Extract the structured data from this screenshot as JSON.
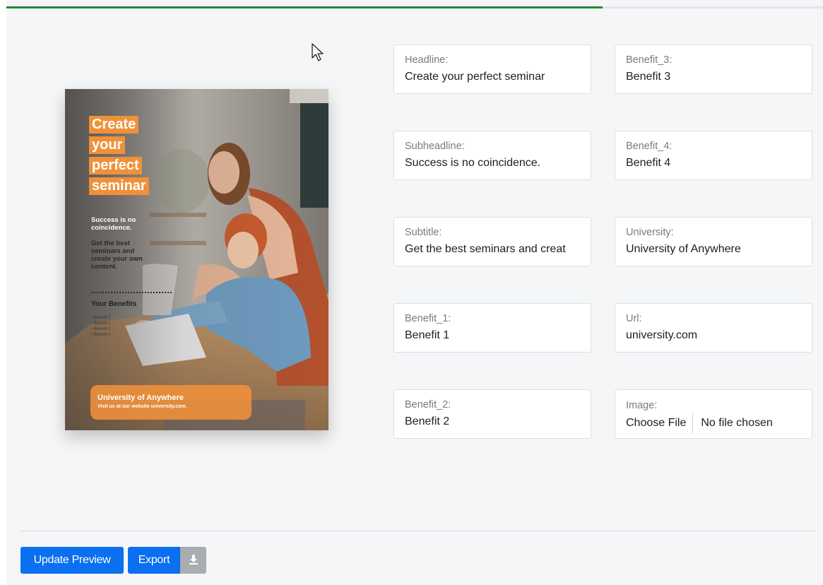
{
  "progress": {
    "fraction": 0.73,
    "color": "#1f8a3a"
  },
  "poster": {
    "headline_lines": [
      "Create",
      "your",
      "perfect",
      "seminar"
    ],
    "subheadline_lines": [
      "Success is no",
      "coincidence."
    ],
    "subtitle_lines": [
      "Get the best",
      "seminars and",
      "create your own",
      "content."
    ],
    "benefits_title": "Your Benefits",
    "benefits": [
      "• Benefit 1",
      "• Benefit 2",
      "• Benefit 3",
      "• Benefit 4"
    ],
    "university": "University of Anywhere",
    "visit_text": "Visit us at our website university.com.",
    "accent": "#f0913a"
  },
  "form": {
    "headline": {
      "label": "Headline:",
      "value": "Create your perfect seminar"
    },
    "subheadline": {
      "label": "Subheadline:",
      "value": "Success is no coincidence."
    },
    "subtitle": {
      "label": "Subtitle:",
      "value": "Get the best seminars and creat"
    },
    "benefit_1": {
      "label": "Benefit_1:",
      "value": "Benefit 1"
    },
    "benefit_2": {
      "label": "Benefit_2:",
      "value": "Benefit 2"
    },
    "benefit_3": {
      "label": "Benefit_3:",
      "value": "Benefit 3"
    },
    "benefit_4": {
      "label": "Benefit_4:",
      "value": "Benefit 4"
    },
    "university": {
      "label": "University:",
      "value": "University of Anywhere"
    },
    "url": {
      "label": "Url:",
      "value": "university.com"
    },
    "image": {
      "label": "Image:",
      "button": "Choose File",
      "status": "No file chosen"
    }
  },
  "actions": {
    "update_preview": "Update Preview",
    "export": "Export",
    "download_icon": "download-icon",
    "primary_color": "#0a6ff0"
  }
}
